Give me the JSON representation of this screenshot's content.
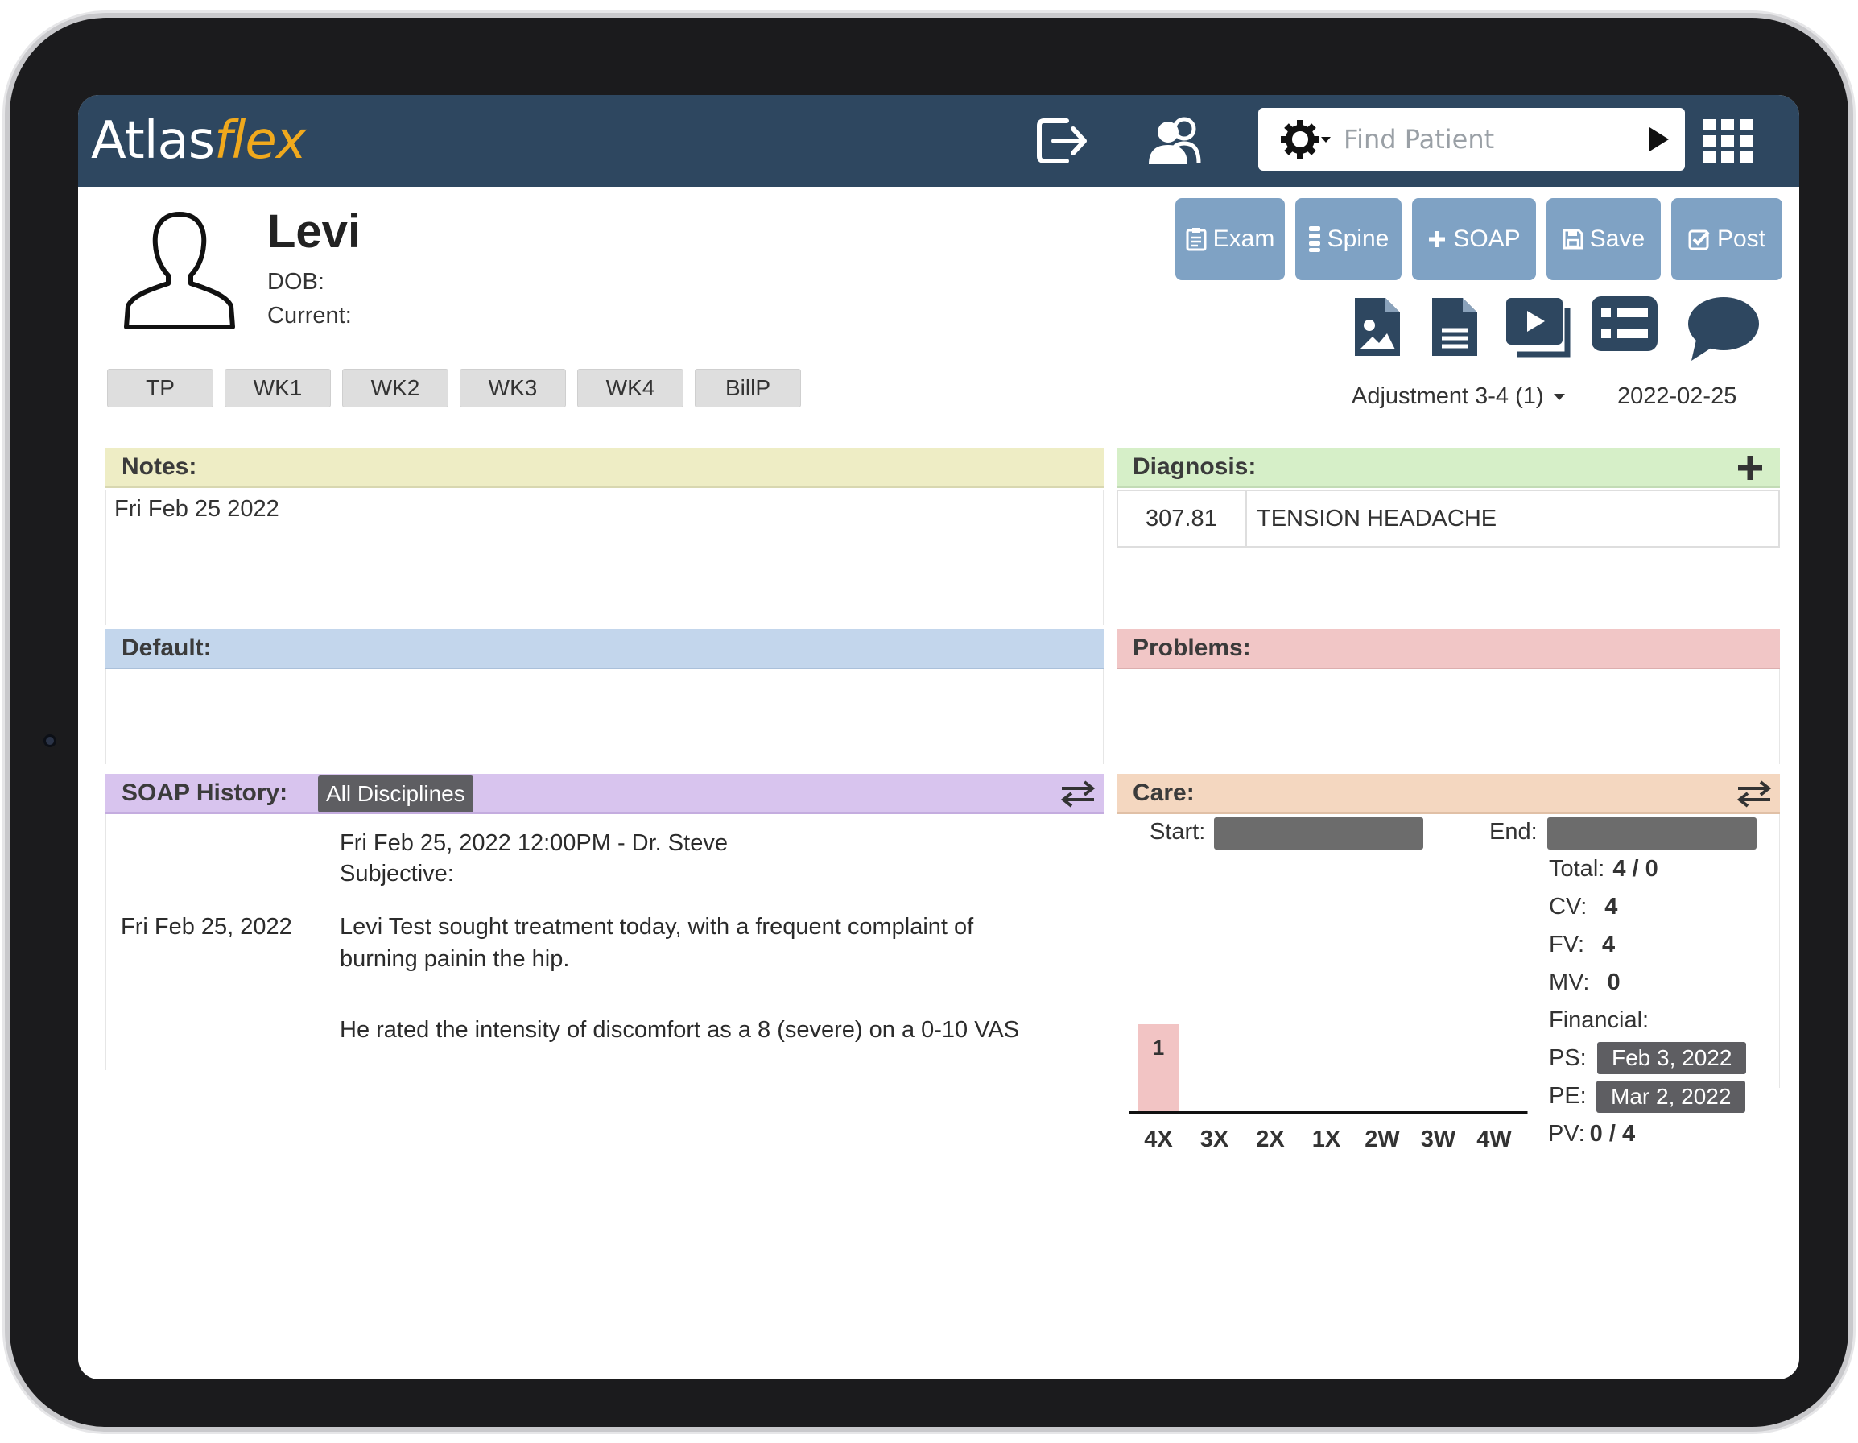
{
  "app": {
    "logo_primary": "Atlas",
    "logo_accent": "flex",
    "search_placeholder": "Find Patient"
  },
  "colors": {
    "topbar": "#2e4760",
    "accent": "#f0a91d",
    "action_button": "#7fa2c4",
    "notes": "#eeedc5",
    "diagnosis": "#d6efc8",
    "default": "#c3d6ec",
    "problems": "#f1c6c6",
    "soap": "#d8c4ee",
    "care": "#f4d7c0"
  },
  "icons": {
    "logout": "sign-out-icon",
    "patients": "users-icon",
    "settings": "gear-icon",
    "go": "play-icon",
    "apps": "grid-icon",
    "avatar": "person-silhouette-icon"
  },
  "patient": {
    "name": "Levi",
    "dob_label": "DOB:",
    "current_label": "Current:"
  },
  "actions": [
    {
      "label": "Exam",
      "icon": "clipboard-icon"
    },
    {
      "label": "Spine",
      "icon": "spine-icon"
    },
    {
      "label": "SOAP",
      "icon": "plus-icon"
    },
    {
      "label": "Save",
      "icon": "floppy-icon"
    },
    {
      "label": "Post",
      "icon": "check-square-icon"
    }
  ],
  "tool_icons": [
    "image-file-icon",
    "document-icon",
    "video-icon",
    "list-icon",
    "chat-icon"
  ],
  "tabs": [
    "TP",
    "WK1",
    "WK2",
    "WK3",
    "WK4",
    "BillP"
  ],
  "visit": {
    "type": "Adjustment 3-4 (1)",
    "date": "2022-02-25"
  },
  "notes": {
    "title": "Notes:",
    "text": "Fri Feb 25 2022"
  },
  "diagnosis": {
    "title": "Diagnosis:",
    "items": [
      {
        "code": "307.81",
        "description": "TENSION HEADACHE"
      }
    ]
  },
  "default": {
    "title": "Default:"
  },
  "problems": {
    "title": "Problems:"
  },
  "soap_history": {
    "title": "SOAP History:",
    "filter": "All Disciplines",
    "entry": {
      "date": "Fri Feb 25, 2022",
      "header": "Fri Feb 25, 2022 12:00PM - Dr. Steve",
      "section": "Subjective:",
      "line1": "Levi Test sought treatment today, with a frequent complaint of",
      "line2": "burning painin the hip.",
      "line3": "He rated the intensity of discomfort as a 8 (severe) on a 0-10 VAS"
    }
  },
  "care": {
    "title": "Care:",
    "start_label": "Start:",
    "end_label": "End:",
    "total_label": "Total:",
    "total_value": "4 / 0",
    "cv_label": "CV:",
    "cv_value": "4",
    "fv_label": "FV:",
    "fv_value": "4",
    "mv_label": "MV:",
    "mv_value": "0",
    "financial_label": "Financial:",
    "ps_label": "PS:",
    "ps_value": "Feb 3, 2022",
    "pe_label": "PE:",
    "pe_value": "Mar 2, 2022",
    "pv_label": "PV:",
    "pv_value": "0 / 4"
  },
  "chart_data": {
    "type": "bar",
    "categories": [
      "4X",
      "3X",
      "2X",
      "1X",
      "2W",
      "3W",
      "4W"
    ],
    "values": [
      1,
      0,
      0,
      0,
      0,
      0,
      0
    ],
    "bar_labels": [
      "1",
      "",
      "",
      "",
      "",
      "",
      ""
    ],
    "bar_color": "#f2c4c4",
    "ylim": [
      0,
      1
    ]
  }
}
